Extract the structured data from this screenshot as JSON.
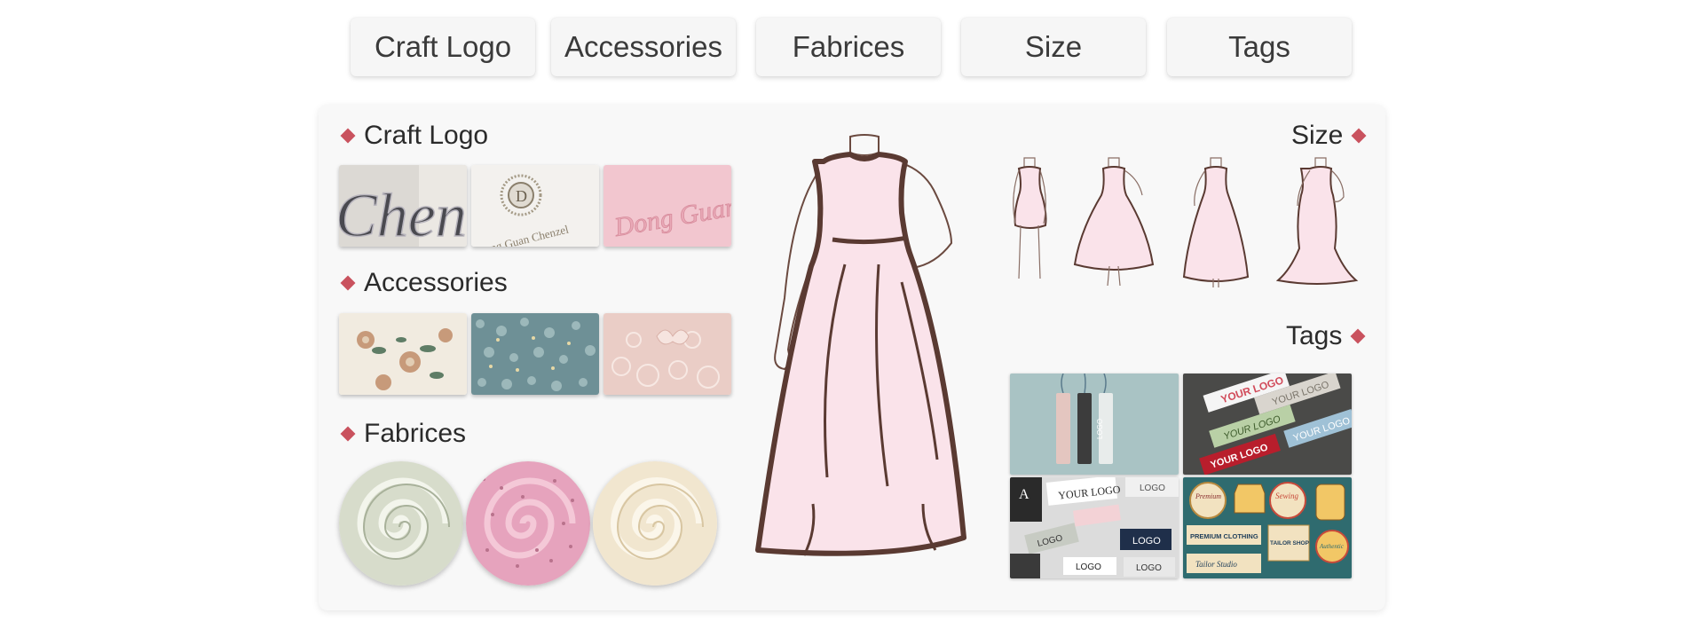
{
  "tabs": [
    {
      "label": "Craft Logo"
    },
    {
      "label": "Accessories"
    },
    {
      "label": "Fabrices"
    },
    {
      "label": "Size"
    },
    {
      "label": "Tags"
    }
  ],
  "sections": {
    "craft_logo": {
      "title": "Craft Logo",
      "samples": [
        "Chen",
        "Dong Guan Chenzel",
        "Dong Guan Chenzel"
      ]
    },
    "accessories": {
      "title": "Accessories"
    },
    "fabrices": {
      "title": "Fabrices"
    },
    "size": {
      "title": "Size"
    },
    "tags": {
      "title": "Tags",
      "samples": {
        "your_logo": "YOUR LOGO",
        "logo": "LOGO",
        "premium": "Premium",
        "premium_clothing": "PREMIUM CLOTHING",
        "tailor_shop": "TAILOR SHOP",
        "tailor_studio": "Tailor Studio",
        "authentic": "Authentic",
        "sewing": "Sewing",
        "letter_a": "A"
      }
    }
  },
  "colors": {
    "accent": "#c9525e",
    "dress_fill": "#fae3ea",
    "dress_outline": "#5a3a32",
    "panel_bg": "#f8f8f8"
  }
}
